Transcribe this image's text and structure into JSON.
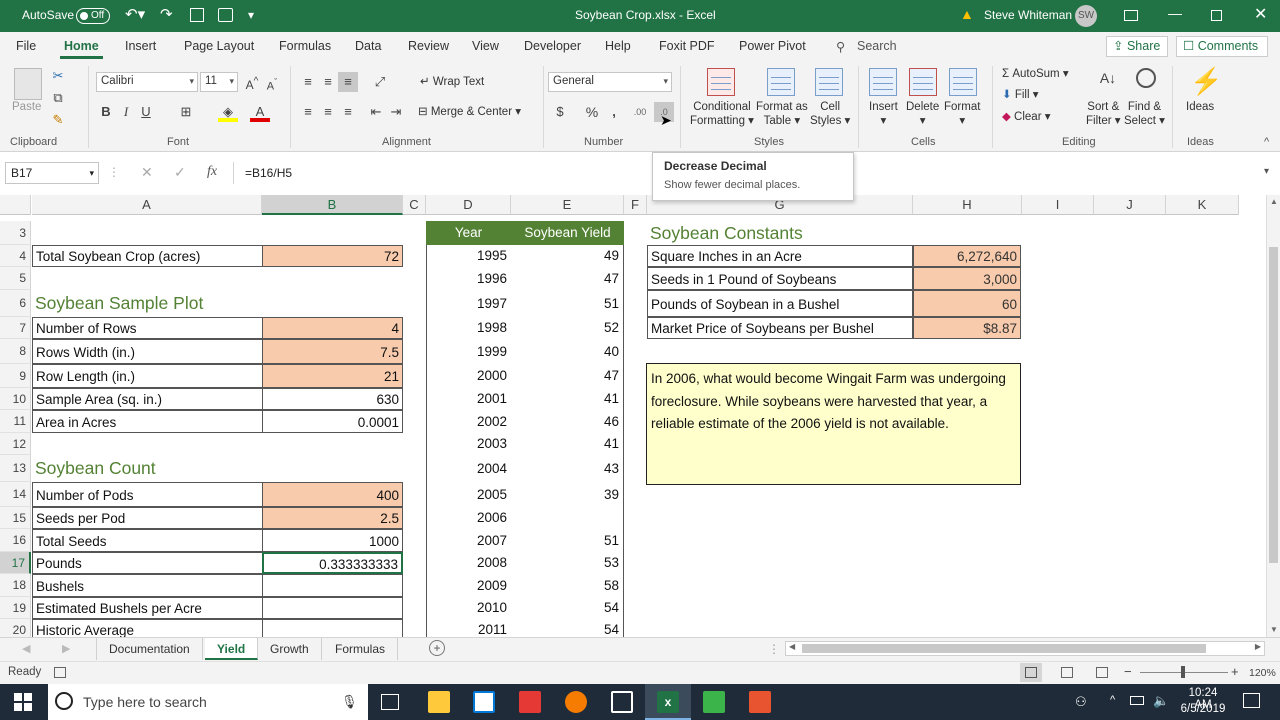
{
  "titlebar": {
    "autosave": "AutoSave",
    "autosave_state": "Off",
    "filename": "Soybean Crop.xlsx - Excel",
    "user": "Steve Whiteman",
    "initials": "SW"
  },
  "tabs": [
    "File",
    "Home",
    "Insert",
    "Page Layout",
    "Formulas",
    "Data",
    "Review",
    "View",
    "Developer",
    "Help",
    "Foxit PDF",
    "Power Pivot"
  ],
  "search_placeholder": "Search",
  "share": "Share",
  "comments": "Comments",
  "ribbon": {
    "clipboard": {
      "paste": "Paste",
      "label": "Clipboard"
    },
    "font": {
      "name": "Calibri",
      "size": "11",
      "label": "Font"
    },
    "alignment": {
      "wrap": "Wrap Text",
      "merge": "Merge & Center",
      "label": "Alignment"
    },
    "number": {
      "format": "General",
      "label": "Number"
    },
    "styles": {
      "cond1": "Conditional",
      "cond2": "Formatting",
      "fmt1": "Format as",
      "fmt2": "Table",
      "cell1": "Cell",
      "cell2": "Styles",
      "label": "Styles"
    },
    "cells": {
      "insert": "Insert",
      "delete": "Delete",
      "format": "Format",
      "label": "Cells"
    },
    "editing": {
      "autosum": "AutoSum",
      "fill": "Fill",
      "clear": "Clear",
      "sort1": "Sort &",
      "sort2": "Filter",
      "find1": "Find &",
      "find2": "Select",
      "label": "Editing"
    },
    "ideas": {
      "ideas": "Ideas",
      "label": "Ideas"
    }
  },
  "tooltip": {
    "title": "Decrease Decimal",
    "desc": "Show fewer decimal places."
  },
  "formula": {
    "namebox": "B17",
    "fx": "fx",
    "value": "=B16/H5"
  },
  "columns": [
    "A",
    "B",
    "C",
    "D",
    "E",
    "F",
    "G",
    "H",
    "I",
    "J",
    "K"
  ],
  "rows": [
    {
      "n": "3",
      "a": "",
      "b": "",
      "d": "Year",
      "e": "Soybean Yield",
      "g": "Soybean Constants",
      "h": ""
    },
    {
      "n": "4",
      "a": "Total Soybean Crop (acres)",
      "b": "72",
      "d": "1995",
      "e": "49",
      "g": "Square Inches in an Acre",
      "h": "6,272,640"
    },
    {
      "n": "5",
      "a": "",
      "b": "",
      "d": "1996",
      "e": "47",
      "g": "Seeds in 1 Pound of Soybeans",
      "h": "3,000"
    },
    {
      "n": "6",
      "a": "Soybean Sample Plot",
      "b": "",
      "d": "1997",
      "e": "51",
      "g": "Pounds of Soybean in a Bushel",
      "h": "60"
    },
    {
      "n": "7",
      "a": "Number of Rows",
      "b": "4",
      "d": "1998",
      "e": "52",
      "g": "Market Price of Soybeans per Bushel",
      "h": "$8.87"
    },
    {
      "n": "8",
      "a": "Rows Width (in.)",
      "b": "7.5",
      "d": "1999",
      "e": "40",
      "g": "",
      "h": ""
    },
    {
      "n": "9",
      "a": "Row Length (in.)",
      "b": "21",
      "d": "2000",
      "e": "47",
      "g": "",
      "h": ""
    },
    {
      "n": "10",
      "a": "Sample Area (sq. in.)",
      "b": "630",
      "d": "2001",
      "e": "41",
      "g": "",
      "h": ""
    },
    {
      "n": "11",
      "a": "Area in Acres",
      "b": "0.0001",
      "d": "2002",
      "e": "46",
      "g": "",
      "h": ""
    },
    {
      "n": "12",
      "a": "",
      "b": "",
      "d": "2003",
      "e": "41",
      "g": "",
      "h": ""
    },
    {
      "n": "13",
      "a": "Soybean Count",
      "b": "",
      "d": "2004",
      "e": "43",
      "g": "",
      "h": ""
    },
    {
      "n": "14",
      "a": "Number of Pods",
      "b": "400",
      "d": "2005",
      "e": "39",
      "g": "",
      "h": ""
    },
    {
      "n": "15",
      "a": "Seeds per Pod",
      "b": "2.5",
      "d": "2006",
      "e": "",
      "g": "",
      "h": ""
    },
    {
      "n": "16",
      "a": "Total Seeds",
      "b": "1000",
      "d": "2007",
      "e": "51",
      "g": "",
      "h": ""
    },
    {
      "n": "17",
      "a": "Pounds",
      "b": "0.333333333",
      "d": "2008",
      "e": "53",
      "g": "",
      "h": ""
    },
    {
      "n": "18",
      "a": "Bushels",
      "b": "",
      "d": "2009",
      "e": "58",
      "g": "",
      "h": ""
    },
    {
      "n": "19",
      "a": "Estimated Bushels per Acre",
      "b": "",
      "d": "2010",
      "e": "54",
      "g": "",
      "h": ""
    },
    {
      "n": "20",
      "a": "Historic Average",
      "b": "",
      "d": "2011",
      "e": "54",
      "g": "",
      "h": ""
    }
  ],
  "note": "In 2006, what would become Wingait Farm was undergoing foreclosure. While soybeans were harvested that year, a reliable estimate of the 2006 yield is not available.",
  "sheets": [
    "Documentation",
    "Yield",
    "Growth",
    "Formulas"
  ],
  "status": {
    "ready": "Ready",
    "zoom": "120%"
  },
  "taskbar": {
    "search": "Type here to search",
    "time": "10:24 AM",
    "date": "6/5/2019"
  },
  "colors": {
    "excel_green": "#217346",
    "orange_fill": "#f8cbad",
    "header_green": "#548235",
    "note_fill": "#ffffcc"
  }
}
